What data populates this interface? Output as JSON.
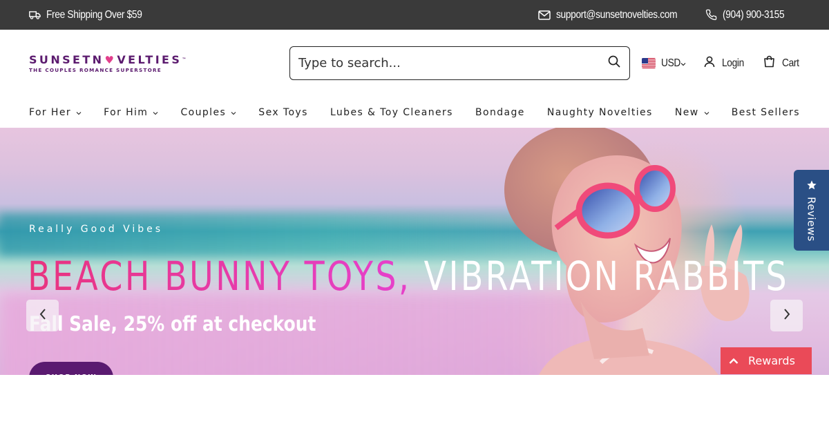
{
  "topbar": {
    "shipping_text": "Free Shipping Over $59",
    "email": "support@sunsetnovelties.com",
    "phone": "(904) 900-3155"
  },
  "logo": {
    "word_part1": "SUNSETN",
    "word_part2": "VELTIES",
    "tagline": "THE COUPLES ROMANCE SUPERSTORE"
  },
  "search": {
    "placeholder": "Type to search..."
  },
  "header": {
    "currency": "USD",
    "login": "Login",
    "cart": "Cart"
  },
  "nav": {
    "items": [
      {
        "label": "For Her",
        "has_dropdown": true
      },
      {
        "label": "For Him",
        "has_dropdown": true
      },
      {
        "label": "Couples",
        "has_dropdown": true
      },
      {
        "label": "Sex Toys",
        "has_dropdown": false
      },
      {
        "label": "Lubes & Toy Cleaners",
        "has_dropdown": false
      },
      {
        "label": "Bondage",
        "has_dropdown": false
      },
      {
        "label": "Naughty Novelties",
        "has_dropdown": false
      },
      {
        "label": "New",
        "has_dropdown": true
      },
      {
        "label": "Best Sellers",
        "has_dropdown": false
      }
    ]
  },
  "hero": {
    "tagline": "Really Good Vibes",
    "headline_pink": "BEACH BUNNY TOYS, ",
    "headline_white": "VIBRATION RABBITS",
    "subheadline": "Fall Sale, 25% off at checkout",
    "cta_label": "SHOP NOW"
  },
  "widgets": {
    "reviews_label": "Reviews",
    "rewards_label": "Rewards"
  },
  "colors": {
    "topbar_bg": "#3a3a3a",
    "brand_purple": "#5b1a6e",
    "brand_pink": "#e23f8c",
    "reviews_bg": "#2a4f85",
    "rewards_bg": "#ea4a58"
  }
}
